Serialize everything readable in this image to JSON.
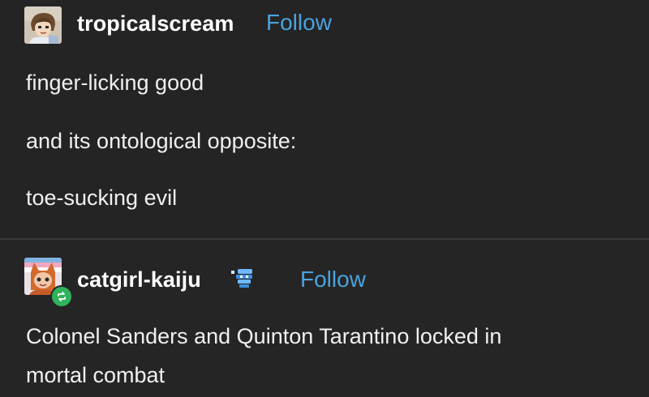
{
  "post1": {
    "username": "tropicalscream",
    "follow_label": "Follow",
    "lines": [
      "finger-licking good",
      "and its ontological opposite:",
      "toe-sucking evil"
    ]
  },
  "post2": {
    "username": "catgirl-kaiju",
    "follow_label": "Follow",
    "lines": [
      "Colonel Sanders and Quinton Tarantino locked in",
      "mortal combat"
    ]
  },
  "icons": {
    "avatar1": "user-avatar-icon",
    "avatar2": "user-avatar-icon",
    "reblog": "reblog-icon",
    "badge": "blog-badge-icon"
  },
  "colors": {
    "background": "#232323",
    "text": "#f0f0f0",
    "follow": "#4aa3df",
    "reblog": "#2fb35a"
  }
}
